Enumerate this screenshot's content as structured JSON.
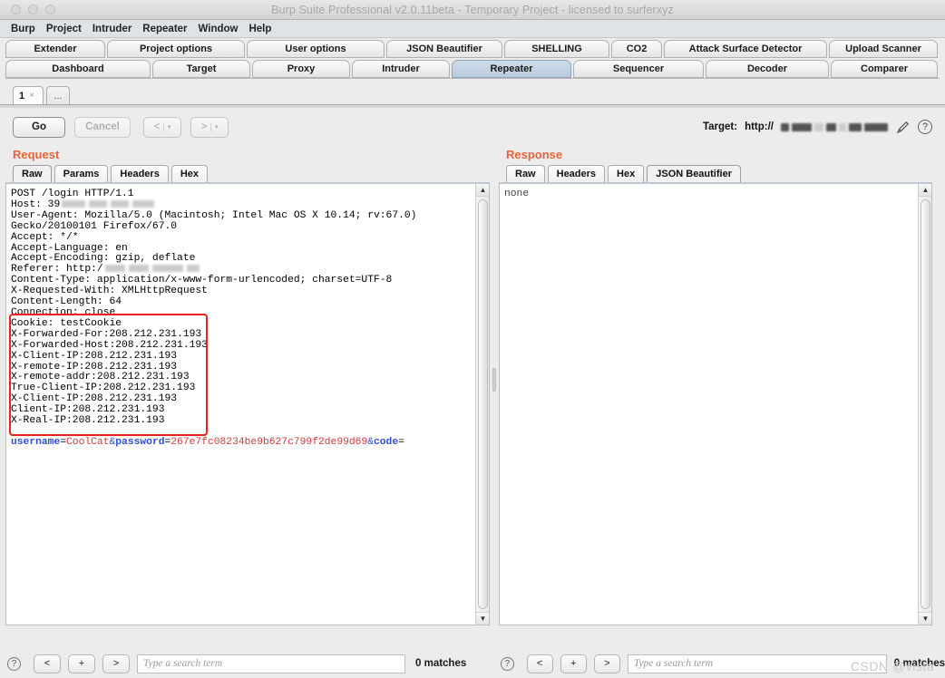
{
  "window": {
    "title": "Burp Suite Professional v2.0.11beta - Temporary Project - licensed to surferxyz",
    "traffic_lights": [
      "close",
      "minimize",
      "maximize"
    ]
  },
  "menu": {
    "items": [
      "Burp",
      "Project",
      "Intruder",
      "Repeater",
      "Window",
      "Help"
    ]
  },
  "main_tabs": {
    "row1": [
      {
        "label": "Extender",
        "selected": false
      },
      {
        "label": "Project options",
        "selected": false
      },
      {
        "label": "User options",
        "selected": false
      },
      {
        "label": "JSON Beautifier",
        "selected": false
      },
      {
        "label": "SHELLING",
        "selected": false
      },
      {
        "label": "CO2",
        "selected": false
      },
      {
        "label": "Attack Surface Detector",
        "selected": false
      },
      {
        "label": "Upload Scanner",
        "selected": false
      }
    ],
    "row2": [
      {
        "label": "Dashboard",
        "selected": false
      },
      {
        "label": "Target",
        "selected": false
      },
      {
        "label": "Proxy",
        "selected": false
      },
      {
        "label": "Intruder",
        "selected": false
      },
      {
        "label": "Repeater",
        "selected": true
      },
      {
        "label": "Sequencer",
        "selected": false
      },
      {
        "label": "Decoder",
        "selected": false
      },
      {
        "label": "Comparer",
        "selected": false
      }
    ]
  },
  "repeater_tabs": {
    "items": [
      {
        "label": "1",
        "close": "×",
        "active": true
      }
    ],
    "add_label": "..."
  },
  "toolbar": {
    "go_label": "Go",
    "cancel_label": "Cancel",
    "back_label": "<",
    "forward_label": ">",
    "dropdown_caret": "▾",
    "separator": "|",
    "target_label": "Target:",
    "target_url_prefix": "http://",
    "target_url_redacted": true,
    "edit_icon": "pencil-icon",
    "help_icon": "question-mark-icon"
  },
  "request": {
    "title": "Request",
    "tabs": [
      {
        "label": "Raw",
        "active": true
      },
      {
        "label": "Params",
        "active": false
      },
      {
        "label": "Headers",
        "active": false
      },
      {
        "label": "Hex",
        "active": false
      }
    ],
    "lines": [
      "POST /login HTTP/1.1",
      "Host: 39",
      "User-Agent: Mozilla/5.0 (Macintosh; Intel Mac OS X 10.14; rv:67.0)",
      "Gecko/20100101 Firefox/67.0",
      "Accept: */*",
      "Accept-Language: en",
      "Accept-Encoding: gzip, deflate",
      "Referer: http:/",
      "Content-Type: application/x-www-form-urlencoded; charset=UTF-8",
      "X-Requested-With: XMLHttpRequest",
      "Content-Length: 64",
      "Connection: close",
      "Cookie: testCookie",
      "X-Forwarded-For:208.212.231.193",
      "X-Forwarded-Host:208.212.231.193",
      "X-Client-IP:208.212.231.193",
      "X-remote-IP:208.212.231.193",
      "X-remote-addr:208.212.231.193",
      "True-Client-IP:208.212.231.193",
      "X-Client-IP:208.212.231.193",
      "Client-IP:208.212.231.193",
      "X-Real-IP:208.212.231.193"
    ],
    "body": {
      "param1_name": "username",
      "param1_value": "CoolCat",
      "param2_name": "password",
      "param2_value": "267e7fc08234be9b627c799f2de99d69",
      "param3_name": "code",
      "param3_value": "",
      "amp": "&",
      "eq": "="
    },
    "annotation": {
      "type": "red-rectangle",
      "color": "#f02020",
      "covers_lines": "X-Forwarded-For through X-Real-IP"
    }
  },
  "response": {
    "title": "Response",
    "tabs": [
      {
        "label": "Raw",
        "active": false
      },
      {
        "label": "Headers",
        "active": false
      },
      {
        "label": "Hex",
        "active": false
      },
      {
        "label": "JSON Beautifier",
        "active": true
      }
    ],
    "body": "none"
  },
  "search_bars": {
    "left": {
      "help_icon": "question-mark-icon",
      "prev_label": "<",
      "add_label": "+",
      "next_label": ">",
      "placeholder": "Type a search term",
      "value": "",
      "matches": "0 matches"
    },
    "right": {
      "help_icon": "question-mark-icon",
      "prev_label": "<",
      "add_label": "+",
      "next_label": ">",
      "placeholder": "Type a search term",
      "value": "",
      "matches": "0 matches"
    }
  },
  "watermark": {
    "text": "CSDN @vista"
  },
  "colors": {
    "accent_orange": "#e8633a",
    "annotation_red": "#f02020",
    "selected_tab_blue": "#bfd0e0",
    "keyword_blue": "#2f4ed8",
    "value_red": "#d23b3b"
  }
}
